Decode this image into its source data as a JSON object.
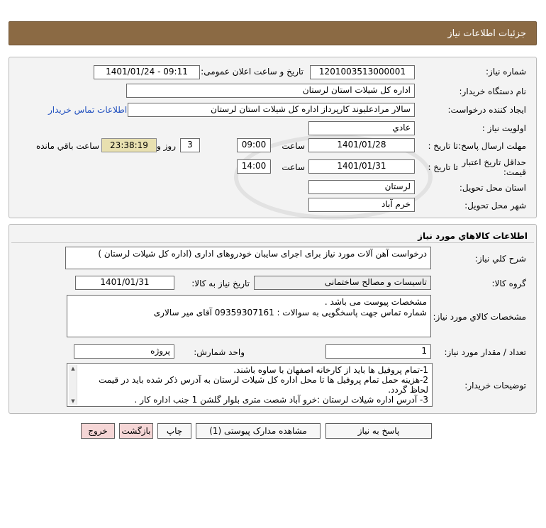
{
  "header": {
    "title": "جزئیات اطلاعات نیاز"
  },
  "details": {
    "need_number_label": "شماره نیاز:",
    "need_number": "1201003513000001",
    "announce_label": "تاریخ و ساعت اعلان عمومی:",
    "announce_value": "1401/01/24 - 09:11",
    "buyer_label": "نام دستگاه خریدار:",
    "buyer_value": "اداره کل شیلات استان لرستان",
    "creator_label": "ایجاد کننده درخواست:",
    "creator_value": "سالار مرادعلیوند کارپرداز اداره کل شیلات استان لرستان",
    "contact_link": "اطلاعات تماس خریدار",
    "priority_label": "اولویت نیاز :",
    "priority_value": "عادي",
    "reply_deadline_label": "مهلت ارسال پاسخ:",
    "to_date_label": "تا تاریخ :",
    "reply_date": "1401/01/28",
    "time_label": "ساعت",
    "reply_time": "09:00",
    "days_value": "3",
    "days_label": "روز و",
    "remaining_time": "23:38:19",
    "remaining_label": "ساعت باقي مانده",
    "price_validity_label": "حداقل تاریخ اعتبار قیمت:",
    "validity_to_label": "تا تاریخ :",
    "validity_date": "1401/01/31",
    "validity_time_label": "ساعت",
    "validity_time": "14:00",
    "province_label": "استان محل تحویل:",
    "province_value": "لرستان",
    "city_label": "شهر محل تحویل:",
    "city_value": "خرم آباد"
  },
  "goods": {
    "section_title": "اطلاعات کالاهاي مورد نياز",
    "summary_label": "شرح کلي نياز:",
    "summary_value": "درخواست آهن آلات مورد نیاز برای اجرای سایبان خودروهای اداری (اداره کل شیلات لرستان )",
    "group_label": "گروه کالا:",
    "group_value": "تاسیسات و مصالح ساختمانی",
    "need_date_label": "تاریخ نیاز به کالا:",
    "need_date_value": "1401/01/31",
    "specs_label": "مشخصات کالاي مورد نياز:",
    "specs_line1": "مشخصات پیوست می باشد .",
    "specs_line2": "شماره تماس جهت پاسخگویی به سوالات : 09359307161 آقای میر سالاری",
    "qty_label": "تعداد / مقدار مورد نیاز:",
    "qty_value": "1",
    "unit_label": "واحد شمارش:",
    "unit_value": "پروژه",
    "notes_label": "توضیحات خریدار:",
    "notes_line1": "1-تمام پروفیل ها باید از کارخانه اصفهان با ساوه باشند.",
    "notes_line2": "2-هزینه حمل تمام پروفیل ها تا محل اداره کل شیلات لرستان به آدرس ذکر شده باید در قیمت لحاظ گردد.",
    "notes_line3": "3- آدرس اداره شیلات لرستان :خرو آباد شصت متری بلوار گلشن 1 جنب اداره کار ."
  },
  "buttons": {
    "reply": "پاسخ به نیاز",
    "attachments": "مشاهده مدارک پیوستی (1)",
    "print": "چاپ",
    "back": "بازگشت",
    "exit": "خروج"
  },
  "colors": {
    "header_bg": "#8b6a44",
    "link": "#1f4fbf",
    "timer_bg": "#e8e0b0",
    "pink_button": "#f5d6d6"
  }
}
